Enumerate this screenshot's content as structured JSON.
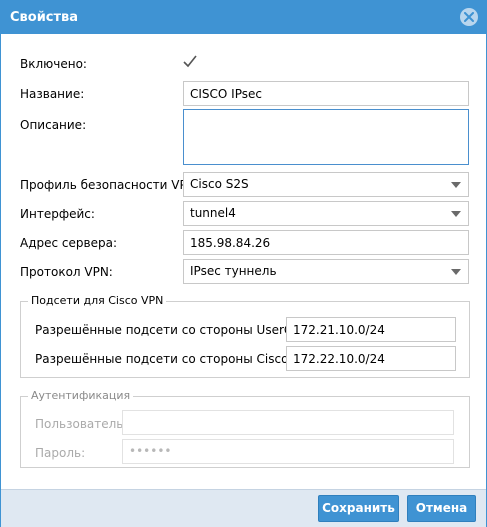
{
  "window": {
    "title": "Свойства",
    "accent_color": "#3f93d3",
    "close_icon": "close-icon"
  },
  "form": {
    "enabled": {
      "label": "Включено:",
      "checked": true
    },
    "name": {
      "label": "Название:",
      "value": "CISCO IPsec"
    },
    "description": {
      "label": "Описание:",
      "value": ""
    },
    "vpn_security_profile": {
      "label": "Профиль безопасности VPN:",
      "value": "Cisco S2S"
    },
    "interface": {
      "label": "Интерфейс:",
      "value": "tunnel4"
    },
    "server_address": {
      "label": "Адрес сервера:",
      "value": "185.98.84.26"
    },
    "vpn_protocol": {
      "label": "Протокол VPN:",
      "value": "IPsec туннель"
    }
  },
  "cisco_subnets": {
    "legend": "Подсети для Cisco VPN",
    "usergate_label": "Разрешённые подсети со стороны UserGate:",
    "usergate_value": "172.21.10.0/24",
    "cisco_label": "Разрешённые подсети со стороны Cisco:",
    "cisco_value": "172.22.10.0/24"
  },
  "authentication": {
    "legend": "Аутентификация",
    "user_label": "Пользователь:",
    "user_value": "",
    "password_label": "Пароль:",
    "password_value": "••••••"
  },
  "footer": {
    "save_label": "Сохранить",
    "cancel_label": "Отмена"
  }
}
